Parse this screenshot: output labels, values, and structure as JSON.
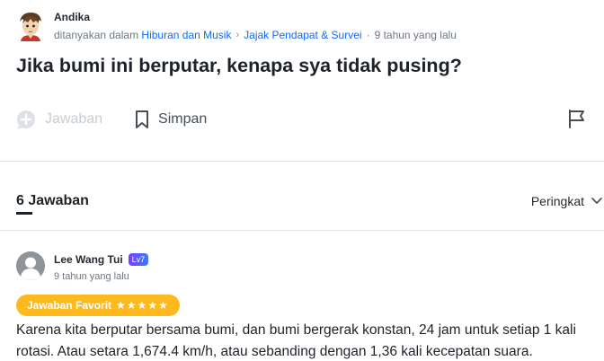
{
  "asker": {
    "name": "Andika",
    "asked_in": "ditanyakan dalam",
    "category_1": "Hiburan dan Musik",
    "category_2": "Jajak Pendapat & Survei",
    "time": "9 tahun yang lalu"
  },
  "question": {
    "title": "Jika bumi ini berputar, kenapa sya tidak pusing?"
  },
  "actions": {
    "answer_label": "Jawaban",
    "save_label": "Simpan"
  },
  "answers_section": {
    "count_label": "6 Jawaban",
    "sort_label": "Peringkat"
  },
  "answer": {
    "author": "Lee Wang Tui",
    "level": "Lv7",
    "time": "9 tahun yang lalu",
    "badge_label": "Jawaban Favorit",
    "badge_stars": "★★★★★",
    "text": "Karena kita berputar bersama bumi, dan bumi bergerak konstan, 24 jam untuk setiap 1 kali rotasi. Atau setara 1,674.4 km/h, atau sebanding dengan 1,36 kali kecepatan suara."
  },
  "colors": {
    "link": "#0f69ff",
    "badge": "#fdb91d",
    "level_badge": "#5a5cff",
    "disabled": "#c7cdd2"
  }
}
